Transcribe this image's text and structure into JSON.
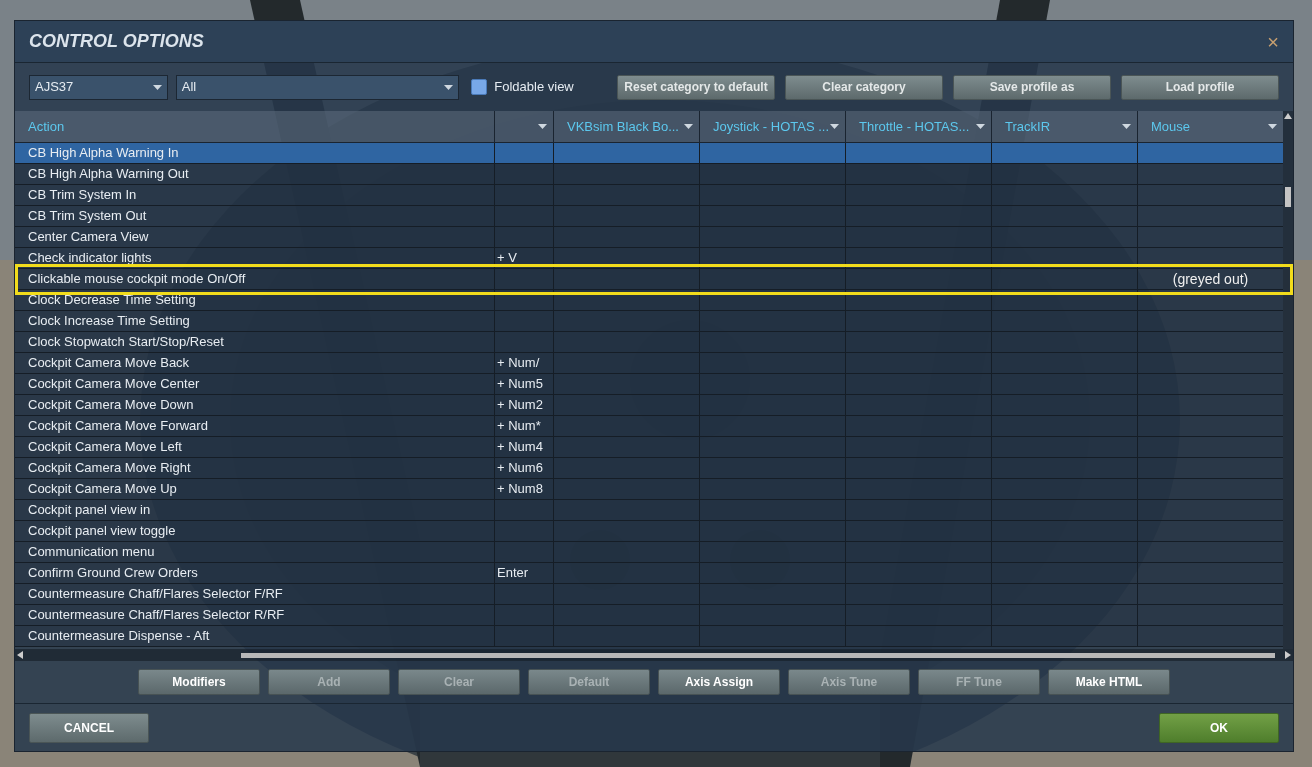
{
  "window": {
    "title": "CONTROL OPTIONS",
    "close": "×"
  },
  "toolbar": {
    "aircraft": "AJS37",
    "category": "All",
    "foldable_view": {
      "label": "Foldable view",
      "checked": false
    },
    "buttons": [
      {
        "label": "Reset category to default"
      },
      {
        "label": "Clear category"
      },
      {
        "label": "Save profile as"
      },
      {
        "label": "Load profile"
      }
    ]
  },
  "table": {
    "columns": [
      {
        "label": "Action",
        "dropdown": false
      },
      {
        "dropdown": true
      },
      {
        "label": "VKBsim Black Bo...",
        "dropdown": true
      },
      {
        "label": "Joystick - HOTAS ...",
        "dropdown": true
      },
      {
        "label": "Throttle - HOTAS...",
        "dropdown": true
      },
      {
        "label": "TrackIR",
        "dropdown": true
      },
      {
        "label": "Mouse",
        "dropdown": true
      }
    ],
    "rows": [
      {
        "action": "CB High Alpha Warning In",
        "selected": true
      },
      {
        "action": "CB High Alpha Warning Out",
        "selected": false
      },
      {
        "action": "CB Trim System In",
        "selected": false
      },
      {
        "action": "CB Trim System Out",
        "selected": false
      },
      {
        "action": "Center Camera View",
        "selected": false
      },
      {
        "action": "Check indicator lights",
        "binding": "+ V",
        "selected": false
      },
      {
        "action": "Clickable mouse cockpit mode On/Off",
        "selected": false,
        "highlighted": true,
        "note": "(greyed out)"
      },
      {
        "action": "Clock Decrease Time Setting",
        "selected": false
      },
      {
        "action": "Clock Increase Time Setting",
        "selected": false
      },
      {
        "action": "Clock Stopwatch Start/Stop/Reset",
        "selected": false
      },
      {
        "action": "Cockpit Camera Move Back",
        "binding": "+ Num/",
        "selected": false
      },
      {
        "action": "Cockpit Camera Move Center",
        "binding": "+ Num5",
        "selected": false
      },
      {
        "action": "Cockpit Camera Move Down",
        "binding": "+ Num2",
        "selected": false
      },
      {
        "action": "Cockpit Camera Move Forward",
        "binding": "+ Num*",
        "selected": false
      },
      {
        "action": "Cockpit Camera Move Left",
        "binding": "+ Num4",
        "selected": false
      },
      {
        "action": "Cockpit Camera Move Right",
        "binding": "+ Num6",
        "selected": false
      },
      {
        "action": "Cockpit Camera Move Up",
        "binding": "+ Num8",
        "selected": false
      },
      {
        "action": "Cockpit panel view in",
        "selected": false
      },
      {
        "action": "Cockpit panel view toggle",
        "selected": false
      },
      {
        "action": "Communication menu",
        "selected": false
      },
      {
        "action": "Confirm Ground Crew Orders",
        "binding": "Enter",
        "selected": false
      },
      {
        "action": "Countermeasure Chaff/Flares Selector F/RF",
        "selected": false
      },
      {
        "action": "Countermeasure Chaff/Flares Selector R/RF",
        "selected": false
      },
      {
        "action": "Countermeasure Dispense - Aft",
        "selected": false
      }
    ]
  },
  "actions": [
    {
      "label": "Modifiers",
      "disabled": false
    },
    {
      "label": "Add",
      "disabled": true
    },
    {
      "label": "Clear",
      "disabled": true
    },
    {
      "label": "Default",
      "disabled": true
    },
    {
      "label": "Axis Assign",
      "disabled": false
    },
    {
      "label": "Axis Tune",
      "disabled": true
    },
    {
      "label": "FF Tune",
      "disabled": true
    },
    {
      "label": "Make HTML",
      "disabled": false
    }
  ],
  "footer": {
    "cancel": "CANCEL",
    "ok": "OK"
  }
}
